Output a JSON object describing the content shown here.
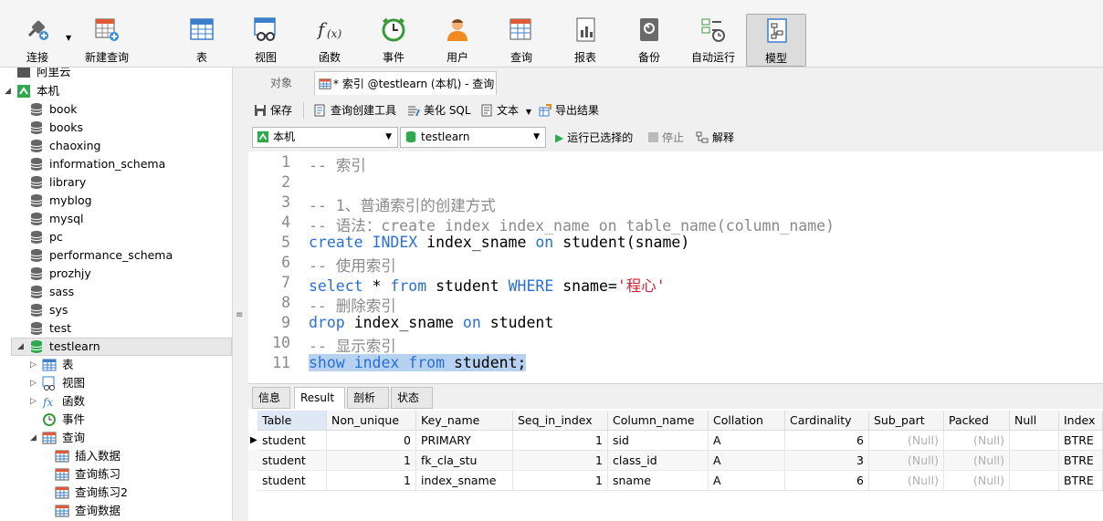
{
  "toolbar": {
    "connect": "连接",
    "new_query": "新建查询",
    "table": "表",
    "view": "视图",
    "function": "函数",
    "event": "事件",
    "user": "用户",
    "query": "查询",
    "report": "报表",
    "backup": "备份",
    "automation": "自动运行",
    "model": "模型"
  },
  "tree": {
    "root_partial": "阿里云",
    "connection": "本机",
    "databases": [
      "book",
      "books",
      "chaoxing",
      "information_schema",
      "library",
      "myblog",
      "mysql",
      "pc",
      "performance_schema",
      "prozhjy",
      "sass",
      "sys",
      "test"
    ],
    "open_db": "testlearn",
    "children": {
      "tables": "表",
      "views": "视图",
      "functions": "函数",
      "events": "事件",
      "queries": "查询"
    },
    "queries": [
      "插入数据",
      "查询练习",
      "查询练习2",
      "查询数据"
    ]
  },
  "tabs": {
    "objects": "对象",
    "query_tab": "* 索引 @testlearn (本机) - 查询"
  },
  "editor_toolbar": {
    "save": "保存",
    "query_builder": "查询创建工具",
    "beautify": "美化 SQL",
    "text": "文本",
    "export": "导出结果"
  },
  "selectors": {
    "connection": "本机",
    "database": "testlearn",
    "run_selected": "运行已选择的",
    "stop": "停止",
    "explain": "解释"
  },
  "code": {
    "line_numbers": [
      "1",
      "2",
      "3",
      "4",
      "5",
      "6",
      "7",
      "8",
      "9",
      "10",
      "11"
    ],
    "l1": "-- 索引",
    "l3": "-- 1、普通索引的创建方式",
    "l4": "-- 语法：create index index_name on table_name(column_name)",
    "l5_a": "create",
    "l5_b": "INDEX",
    "l5_c": "index_sname",
    "l5_d": "on",
    "l5_e": "student(sname)",
    "l6": "-- 使用索引",
    "l7_a": "select",
    "l7_b": "*",
    "l7_c": "from",
    "l7_d": "student",
    "l7_e": "WHERE",
    "l7_f": "sname=",
    "l7_g": "'程心'",
    "l8": "-- 删除索引",
    "l9_a": "drop",
    "l9_b": "index_sname",
    "l9_c": "on",
    "l9_d": "student",
    "l10": "-- 显示索引",
    "l11_a": "show",
    "l11_b": "index",
    "l11_c": "from",
    "l11_d": "student;"
  },
  "result_tabs": [
    "信息",
    "Result 1",
    "剖析",
    "状态"
  ],
  "grid": {
    "columns": [
      "Table",
      "Non_unique",
      "Key_name",
      "Seq_in_index",
      "Column_name",
      "Collation",
      "Cardinality",
      "Sub_part",
      "Packed",
      "Null",
      "Index"
    ],
    "rows": [
      [
        "student",
        "0",
        "PRIMARY",
        "1",
        "sid",
        "A",
        "6",
        "(Null)",
        "(Null)",
        "",
        "BTRE"
      ],
      [
        "student",
        "1",
        "fk_cla_stu",
        "1",
        "class_id",
        "A",
        "3",
        "(Null)",
        "(Null)",
        "",
        "BTRE"
      ],
      [
        "student",
        "1",
        "index_sname",
        "1",
        "sname",
        "A",
        "6",
        "(Null)",
        "(Null)",
        "",
        "BTRE"
      ]
    ]
  }
}
